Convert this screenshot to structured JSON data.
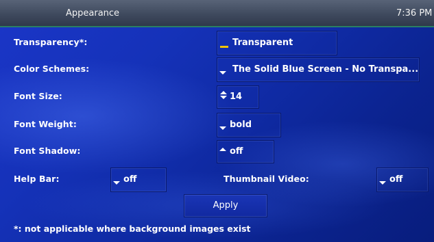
{
  "window": {
    "title": "Appearance",
    "clock": "7:36 PM"
  },
  "settings": {
    "transparency": {
      "label": "Transparency*:",
      "value": "Transparent"
    },
    "color_schemes": {
      "label": "Color Schemes:",
      "value": "The Solid Blue Screen - No Transpa..."
    },
    "font_size": {
      "label": "Font Size:",
      "value": "14"
    },
    "font_weight": {
      "label": "Font Weight:",
      "value": "bold"
    },
    "font_shadow": {
      "label": "Font Shadow:",
      "value": "off"
    },
    "help_bar": {
      "label": "Help Bar:",
      "value": "off"
    },
    "thumbnail_video": {
      "label": "Thumbnail Video:",
      "value": "off"
    }
  },
  "actions": {
    "apply_label": "Apply"
  },
  "footnote": "*: not applicable where background images exist",
  "colors": {
    "background": "#1532b9",
    "titlebar": "#4b566b",
    "accent_line": "#2b7f63",
    "indicator": "#f2c400"
  },
  "icons": [
    "indicator-icon",
    "chevron-down-icon",
    "up-down-arrows-icon",
    "chevron-up-icon"
  ]
}
